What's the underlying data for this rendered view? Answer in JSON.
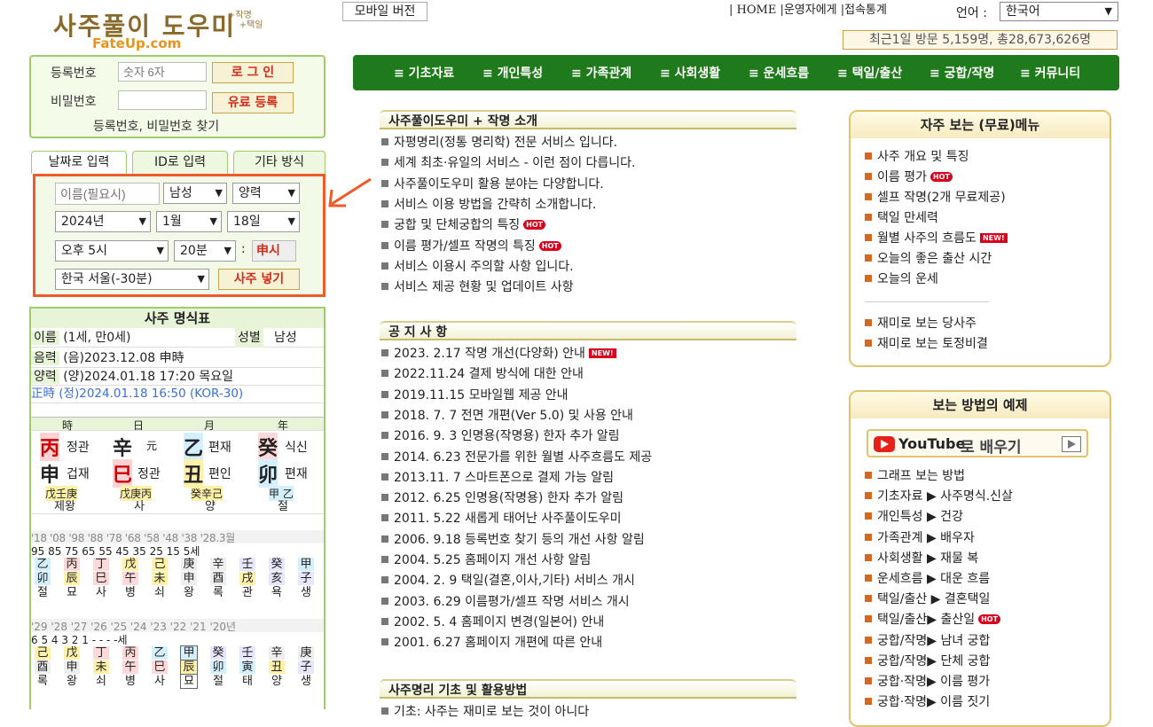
{
  "logo": {
    "main": "사주풀이 도우미",
    "sub1": "+작명",
    "sub2": "+택일",
    "site": "FateUp.com"
  },
  "login": {
    "id_label": "등록번호",
    "id_placeholder": "숫자 6자",
    "pw_label": "비밀번호",
    "login_btn": "로 그 인",
    "register_btn": "유료 등록",
    "find_link": "등록번호, 비밀번호 찾기"
  },
  "input_tabs": [
    "날짜로 입력",
    "ID로 입력",
    "기타 방식"
  ],
  "form": {
    "name_placeholder": "이름(필요시)",
    "gender": "남성",
    "calendar": "양력",
    "year": "2024년",
    "month": "1월",
    "day": "18일",
    "hour": "오후 5시",
    "minute": "20분",
    "sep": ":",
    "sichen": "申시",
    "location": "한국 서울(-30분)",
    "submit": "사주 넣기"
  },
  "header": {
    "mobile": "모바일 버전",
    "links": "| HOME  |운영자에게 |접속통계",
    "lang_label": "언어 :",
    "lang_value": "한국어",
    "visits": "최근1일 방문 5,159명, 총28,673,626명"
  },
  "nav": [
    "≡ 기초자료",
    "≡ 개인특성",
    "≡ 가족관계",
    "≡ 사회생활",
    "≡ 운세흐름",
    "≡ 택일/출산",
    "≡ 궁합/작명",
    "≡ 커뮤니티"
  ],
  "saju": {
    "title": "사주 명식표",
    "name_label": "이름",
    "name_value": "(1세, 만0세)",
    "gender_label": "성별",
    "gender_value": "남성",
    "lunar_label": "음력",
    "lunar_value": "(음)2023.12.08 申時",
    "solar_label": "양력",
    "solar_value": "(양)2024.01.18 17:20 목요일",
    "jeongsi": "正時 (정)2024.01.18 16:50 (KOR-30)",
    "pillar_heads": [
      "時",
      "日",
      "月",
      "年"
    ],
    "stems": [
      {
        "c": "丙",
        "t": "정관"
      },
      {
        "c": "辛",
        "t": "元"
      },
      {
        "c": "乙",
        "t": "편재"
      },
      {
        "c": "癸",
        "t": "식신"
      }
    ],
    "branches": [
      {
        "c": "申",
        "t": "겁재"
      },
      {
        "c": "巳",
        "t": "정관"
      },
      {
        "c": "丑",
        "t": "편인"
      },
      {
        "c": "卯",
        "t": "편재"
      }
    ],
    "hidden": [
      "戊壬庚",
      "戊庚丙",
      "癸辛己",
      "甲 乙"
    ],
    "stages": [
      "제왕",
      "사",
      "양",
      "절"
    ],
    "daeun_years": "'18 '08 '98 '88 '78 '68 '58 '48 '38 '28.3월",
    "daeun_ages": "95 85 75 65 55 45 35 25 15   5세",
    "daeun_stems": [
      "乙",
      "丙",
      "丁",
      "戊",
      "己",
      "庚",
      "辛",
      "壬",
      "癸",
      "甲"
    ],
    "daeun_branches": [
      "卯",
      "辰",
      "巳",
      "午",
      "未",
      "申",
      "酉",
      "戌",
      "亥",
      "子"
    ],
    "daeun_stages": [
      "절",
      "묘",
      "사",
      "병",
      "쇠",
      "왕",
      "록",
      "관",
      "욕",
      "생"
    ],
    "seun_years": "'29 '28 '27 '26 '25 '24 '23 '22 '21 '20년",
    "seun_ages": "6   5   4   3   2   1   -   -   -   -세",
    "seun_stems": [
      "己",
      "戊",
      "丁",
      "丙",
      "乙",
      "甲",
      "癸",
      "壬",
      "辛",
      "庚"
    ],
    "seun_branches": [
      "酉",
      "申",
      "未",
      "午",
      "巳",
      "辰",
      "卯",
      "寅",
      "丑",
      "子"
    ],
    "seun_stages": [
      "록",
      "왕",
      "쇠",
      "병",
      "사",
      "묘",
      "절",
      "태",
      "양",
      "생"
    ]
  },
  "intro": {
    "title": "사주풀이도우미 + 작명 소개",
    "items": [
      {
        "t": "자평명리(정통 명리학) 전문 서비스 입니다."
      },
      {
        "t": "세계 최초·유일의 서비스 - 이런 점이 다릅니다."
      },
      {
        "t": "사주풀이도우미 활용 분야는 다양합니다."
      },
      {
        "t": "서비스 이용 방법을 간략히 소개합니다."
      },
      {
        "t": "궁합 및 단체궁합의 특징",
        "badge": "HOT"
      },
      {
        "t": "이름 평가/셀프 작명의 특징",
        "badge": "HOT"
      },
      {
        "t": "서비스 이용시 주의할 사항 입니다."
      },
      {
        "t": "서비스 제공 현황 및 업데이트 사항"
      }
    ]
  },
  "notice": {
    "title": "공 지 사 항",
    "items": [
      {
        "t": "2023. 2.17 작명 개선(다양화) 안내",
        "badge": "NEW!"
      },
      {
        "t": "2022.11.24 결제 방식에 대한 안내"
      },
      {
        "t": "2019.11.15 모바일웹 제공 안내"
      },
      {
        "t": "2018. 7. 7 전면 개편(Ver 5.0) 및 사용 안내"
      },
      {
        "t": "2016. 9. 3 인명용(작명용) 한자 추가 알림"
      },
      {
        "t": "2014. 6.23 전문가를 위한 월별 사주흐름도 제공"
      },
      {
        "t": "2013.11. 7 스마트폰으로 결제 가능 알림"
      },
      {
        "t": "2012. 6.25 인명용(작명용) 한자 추가 알림"
      },
      {
        "t": "2011. 5.22 새롭게 태어난 사주풀이도우미"
      },
      {
        "t": "2006. 9.18 등록번호 찾기 등의 개선 사항 알림"
      },
      {
        "t": "2004. 5.25 홈페이지 개선 사항 알림"
      },
      {
        "t": "2004. 2. 9 택일(결혼,이사,기타) 서비스 개시"
      },
      {
        "t": "2003. 6.29 이름평가/셀프 작명 서비스 개시"
      },
      {
        "t": "2002. 5. 4 홈페이지 변경(일본어) 안내"
      },
      {
        "t": "2001. 6.27 홈페이지 개편에 따른 안내"
      }
    ]
  },
  "basics": {
    "title": "사주명리 기초 및 활용방법",
    "first_item": "기초: 사주는 재미로 보는 것이 아니다"
  },
  "freemenu": {
    "title": "자주 보는 (무료)메뉴",
    "items": [
      {
        "t": "사주 개요 및 특징"
      },
      {
        "t": "이름 평가",
        "badge": "HOT"
      },
      {
        "t": "셀프 작명(2개 무료제공)"
      },
      {
        "t": "택일 만세력"
      },
      {
        "t": "월별 사주의 흐름도",
        "badge": "NEW!"
      },
      {
        "t": "오늘의 좋은 출산 시간"
      },
      {
        "t": "오늘의 운세"
      },
      {
        "t": "재미로 보는 당사주"
      },
      {
        "t": "재미로 보는 토정비결"
      }
    ]
  },
  "examples": {
    "title": "보는 방법의 예제",
    "youtube_logo": "YouTube",
    "youtube_text": "로 배우기",
    "items": [
      {
        "t": "그래프 보는 방법"
      },
      {
        "t": "기초자료 ▶ 사주명식.신살"
      },
      {
        "t": "개인특성 ▶ 건강"
      },
      {
        "t": "가족관계 ▶ 배우자"
      },
      {
        "t": "사회생활 ▶ 재물 복"
      },
      {
        "t": "운세흐름 ▶ 대운 흐름"
      },
      {
        "t": "택일/출산 ▶ 결혼택일"
      },
      {
        "t": "택일/출산▶ 출산일",
        "badge": "HOT"
      },
      {
        "t": "궁합/작명▶ 남녀 궁합"
      },
      {
        "t": "궁합/작명▶ 단체 궁합"
      },
      {
        "t": "궁합·작명▶ 이름 평가"
      },
      {
        "t": "궁합·작명▶ 이름 짓기"
      }
    ]
  }
}
